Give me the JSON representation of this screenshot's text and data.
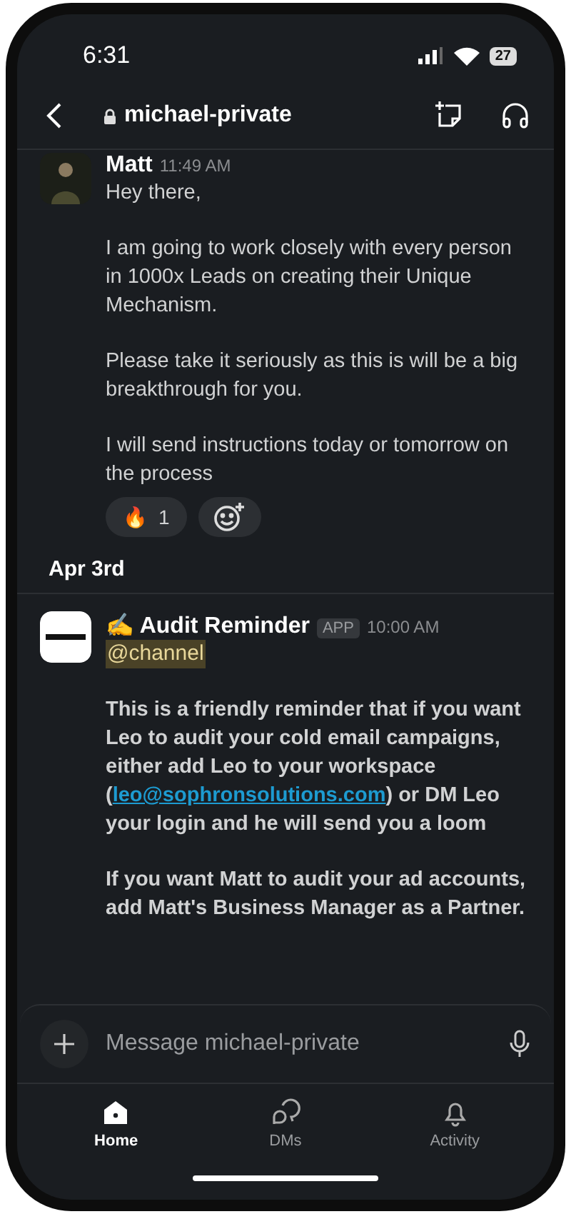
{
  "status_bar": {
    "time": "6:31",
    "battery": "27"
  },
  "header": {
    "channel": "michael-private"
  },
  "messages": [
    {
      "kind": "user",
      "author": "Matt",
      "time": "11:49 AM",
      "paragraphs": [
        {
          "text": "Hey there,"
        },
        {
          "text": "I am going to work closely with every person in 1000x Leads on creating their Unique Mechanism."
        },
        {
          "text": "Please take it seriously as this is will be a big breakthrough for you."
        },
        {
          "text": "I will send instructions today or tomorrow on the process"
        }
      ],
      "reactions": [
        {
          "emoji": "🔥",
          "count": "1"
        }
      ]
    },
    {
      "kind": "divider",
      "label": "Apr 3rd"
    },
    {
      "kind": "app",
      "author": "✍️ Audit Reminder",
      "badge": "APP",
      "time": "10:00 AM",
      "mention": "@channel",
      "paragraphs": [
        {
          "text": "This is a friendly reminder that if you want Leo to audit your cold email campaigns, either add Leo to your workspace (",
          "link": "leo@sophronsolutions.com",
          "after": ") or DM Leo your login and he will send you a loom"
        },
        {
          "text": "If you want Matt to audit your ad accounts, add Matt's Business Manager as a Partner."
        }
      ]
    }
  ],
  "composer": {
    "placeholder": "Message michael-private"
  },
  "tabs": [
    {
      "label": "Home",
      "selected": true
    },
    {
      "label": "DMs",
      "selected": false
    },
    {
      "label": "Activity",
      "selected": false
    }
  ]
}
